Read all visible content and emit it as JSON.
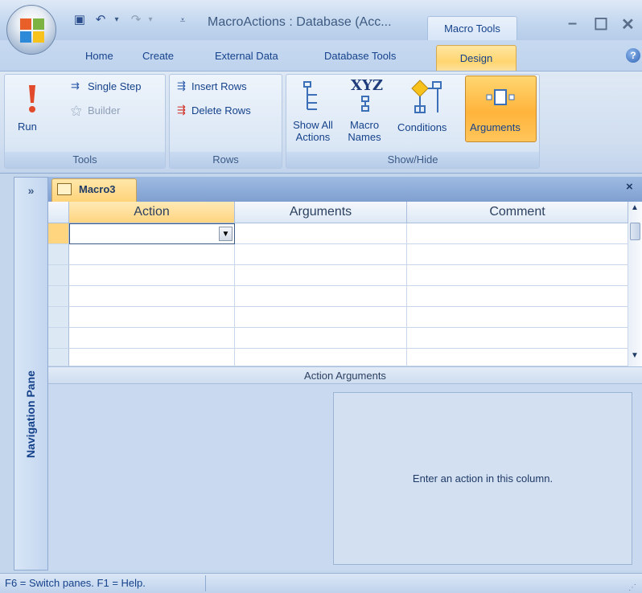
{
  "window": {
    "title": "MacroActions : Database (Acc...",
    "context_tab": "Macro Tools",
    "minimize": "–",
    "maximize": "☐",
    "close": "✕"
  },
  "ribbon_tabs": {
    "home": "Home",
    "create": "Create",
    "external_data": "External Data",
    "database_tools": "Database Tools",
    "design": "Design"
  },
  "ribbon": {
    "tools": {
      "label": "Tools",
      "run": "Run",
      "single_step": "Single Step",
      "builder": "Builder"
    },
    "rows": {
      "label": "Rows",
      "insert_rows": "Insert Rows",
      "delete_rows": "Delete Rows"
    },
    "show_hide": {
      "label": "Show/Hide",
      "show_all_actions_1": "Show All",
      "show_all_actions_2": "Actions",
      "macro_names_1": "Macro",
      "macro_names_2": "Names",
      "macro_names_icon": "XYZ",
      "conditions": "Conditions",
      "arguments": "Arguments"
    }
  },
  "nav_pane": {
    "label": "Navigation Pane",
    "toggle": "»"
  },
  "document": {
    "tab_label": "Macro3",
    "close": "×"
  },
  "grid": {
    "columns": [
      "Action",
      "Arguments",
      "Comment"
    ]
  },
  "action_arguments": {
    "label": "Action Arguments",
    "help_text": "Enter an action in this column."
  },
  "status_bar": {
    "text": "F6 = Switch panes.  F1 = Help."
  },
  "colors": {
    "accent": "#ffd56f",
    "ribbon_text": "#15428b"
  }
}
